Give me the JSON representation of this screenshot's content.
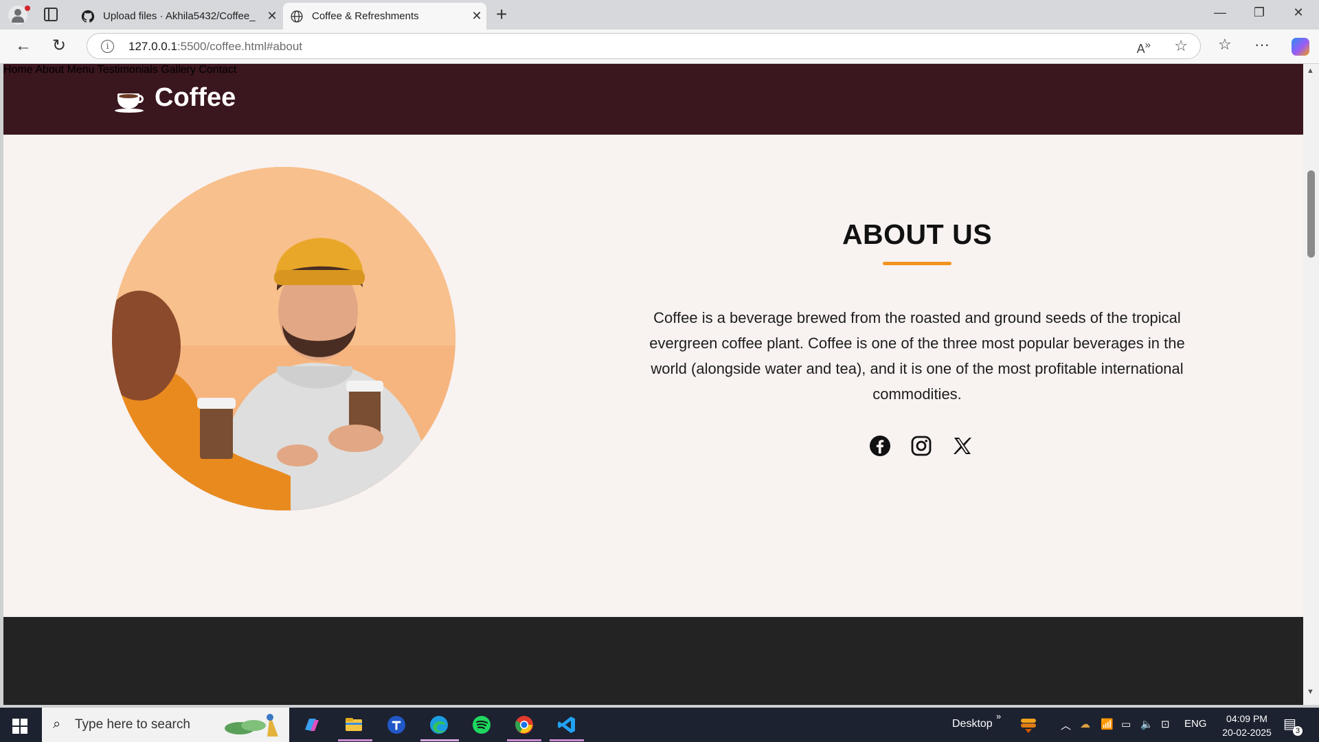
{
  "browser": {
    "tabs": [
      {
        "title": "Upload files · Akhila5432/Coffee_",
        "active": false
      },
      {
        "title": "Coffee & Refreshments",
        "active": true
      }
    ],
    "url_host": "127.0.0.1",
    "url_rest": ":5500/coffee.html#about"
  },
  "site": {
    "brand": "Coffee",
    "nav": [
      "Home",
      "About",
      "Menu",
      "Testimonials",
      "Gallery",
      "Contact"
    ],
    "about_title": "ABOUT US",
    "about_text": "Coffee is a beverage brewed from the roasted and ground seeds of the tropical evergreen coffee plant. Coffee is one of the three most popular beverages in the world (alongside water and tea), and it is one of the most profitable international commodities.",
    "social": [
      "facebook-icon",
      "instagram-icon",
      "x-icon"
    ],
    "accent_color": "#f0931f",
    "header_color": "#3a161e"
  },
  "taskbar": {
    "search_placeholder": "Type here to search",
    "desktop_label": "Desktop",
    "language": "ENG",
    "time": "04:09 PM",
    "date": "20-02-2025",
    "notification_count": "3"
  }
}
